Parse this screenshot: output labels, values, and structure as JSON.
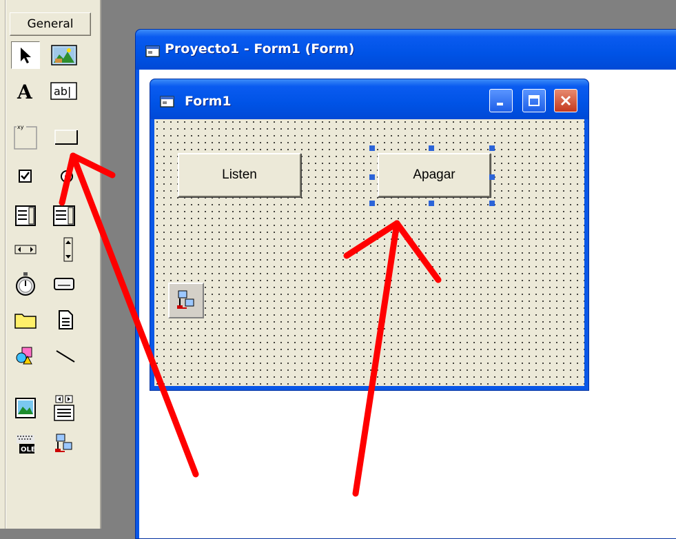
{
  "toolbox": {
    "tab_label": "General",
    "tools": [
      {
        "name": "pointer-tool-icon"
      },
      {
        "name": "picturebox-tool-icon"
      },
      {
        "name": "label-tool-icon",
        "glyph": "A"
      },
      {
        "name": "textbox-tool-icon",
        "glyph": "ab|"
      },
      {
        "name": "frame-tool-icon",
        "glyph": "xy"
      },
      {
        "name": "commandbutton-tool-icon"
      },
      {
        "name": "checkbox-tool-icon"
      },
      {
        "name": "optionbutton-tool-icon"
      },
      {
        "name": "combobox-tool-icon"
      },
      {
        "name": "listbox-tool-icon"
      },
      {
        "name": "hscrollbar-tool-icon"
      },
      {
        "name": "vscrollbar-tool-icon"
      },
      {
        "name": "timer-tool-icon"
      },
      {
        "name": "drivelistbox-tool-icon"
      },
      {
        "name": "dirlistbox-tool-icon"
      },
      {
        "name": "filelistbox-tool-icon"
      },
      {
        "name": "shape-tool-icon"
      },
      {
        "name": "line-tool-icon"
      },
      {
        "name": "image-tool-icon"
      },
      {
        "name": "data-tool-icon"
      },
      {
        "name": "ole-tool-icon",
        "glyph": "OLE"
      },
      {
        "name": "winsock-tool-icon"
      }
    ]
  },
  "project_window": {
    "title": "Proyecto1 - Form1 (Form)"
  },
  "form": {
    "title": "Form1",
    "buttons": {
      "listen": "Listen",
      "apagar": "Apagar"
    }
  },
  "colors": {
    "titlebar": "#0053e6",
    "annotation": "#ff0000",
    "selection_handle": "#2c64d8",
    "form_background": "#ece9d8"
  }
}
